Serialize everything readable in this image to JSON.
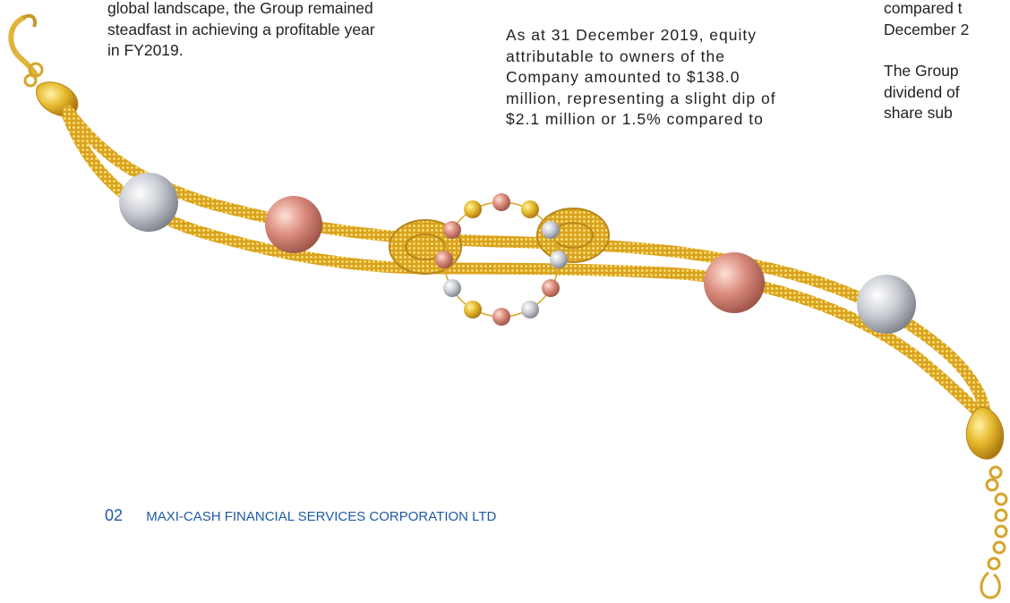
{
  "column1": {
    "lines": [
      "global landscape, the Group remained",
      "steadfast in achieving a profitable year",
      "in FY2019."
    ]
  },
  "column2": {
    "lines": [
      "As at 31 December 2019, equity",
      "attributable to owners of the",
      "Company amounted to $138.0",
      "million, representing a slight dip of",
      "$2.1 million or 1.5% compared to"
    ]
  },
  "column3": {
    "p1_lines": [
      "compared t",
      "December 2"
    ],
    "p2_lines": [
      "The Group",
      "dividend of",
      "share sub"
    ]
  },
  "footer": {
    "page_number": "02",
    "company_name": "MAXI-CASH FINANCIAL SERVICES CORPORATION LTD"
  },
  "colors": {
    "footer_blue": "#1e5ba6",
    "gold": "#e5b82a",
    "rose_gold": "#d98a7c",
    "white_gold": "#c9ccd3"
  },
  "image": {
    "subject": "bracelet",
    "beads": [
      "white-gold",
      "rose-gold",
      "rose-gold",
      "white-gold"
    ]
  }
}
